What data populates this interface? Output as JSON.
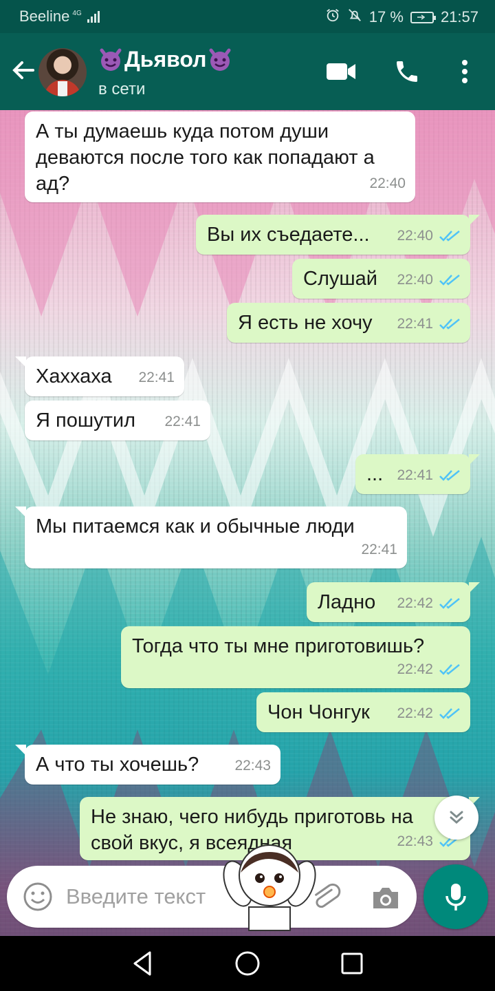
{
  "status_bar": {
    "carrier": "Beeline",
    "network": "4G",
    "battery": "17 %",
    "time": "21:57",
    "icons": [
      "alarm-icon",
      "mute-icon",
      "battery-icon",
      "signal-icon"
    ]
  },
  "header": {
    "contact_name": "Дьявол",
    "status": "в сети",
    "icons": [
      "back-arrow-icon",
      "devil-emoji-icon",
      "video-call-icon",
      "phone-icon",
      "more-vert-icon"
    ]
  },
  "messages": [
    {
      "dir": "in",
      "text": "А ты думаешь куда потом души деваются после того как попадают а ад?",
      "time": "22:40"
    },
    {
      "dir": "out",
      "text": "Вы их съедаете...",
      "time": "22:40",
      "read": true
    },
    {
      "dir": "out",
      "text": "Слушай",
      "time": "22:40",
      "read": true
    },
    {
      "dir": "out",
      "text": "Я есть не хочу",
      "time": "22:41",
      "read": true
    },
    {
      "dir": "in",
      "text": "Хаххаха",
      "time": "22:41"
    },
    {
      "dir": "in",
      "text": "Я пошутил",
      "time": "22:41"
    },
    {
      "dir": "out",
      "text": "...",
      "time": "22:41",
      "read": true
    },
    {
      "dir": "in",
      "text": "Мы питаемся как и обычные люди",
      "time": "22:41"
    },
    {
      "dir": "out",
      "text": "Ладно",
      "time": "22:42",
      "read": true
    },
    {
      "dir": "out",
      "text": "Тогда что ты мне приготовишь?",
      "time": "22:42",
      "read": true
    },
    {
      "dir": "out",
      "text": "Чон Чонгук",
      "time": "22:42",
      "read": true
    },
    {
      "dir": "in",
      "text": "А что ты хочешь?",
      "time": "22:43"
    },
    {
      "dir": "out",
      "text": "Не знаю, чего нибудь приготовь на свой вкус, я всеядная",
      "time": "22:43",
      "read": true
    }
  ],
  "input": {
    "placeholder": "Введите текст"
  },
  "colors": {
    "header": "#075e54",
    "statusbar": "#05544b",
    "outgoing": "#dcf8c6",
    "incoming": "#ffffff",
    "read_ticks": "#4fc3f7",
    "mic": "#00897b"
  }
}
